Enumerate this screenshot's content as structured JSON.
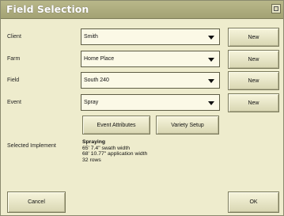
{
  "window": {
    "title": "Field Selection"
  },
  "rows": [
    {
      "label": "Client",
      "value": "Smith",
      "button": "New"
    },
    {
      "label": "Farm",
      "value": "Home Place",
      "button": "New"
    },
    {
      "label": "Field",
      "value": "South 240",
      "button": "New"
    },
    {
      "label": "Event",
      "value": "Spray",
      "button": "New"
    }
  ],
  "actions": {
    "event_attributes": "Event Attributes",
    "variety_setup": "Variety Setup"
  },
  "implement": {
    "label": "Selected Implement",
    "name": "Spraying",
    "lines": [
      "65' 7.4\" swath width",
      "68' 10.77\" application width",
      "32 rows"
    ]
  },
  "footer": {
    "cancel": "Cancel",
    "ok": "OK"
  }
}
